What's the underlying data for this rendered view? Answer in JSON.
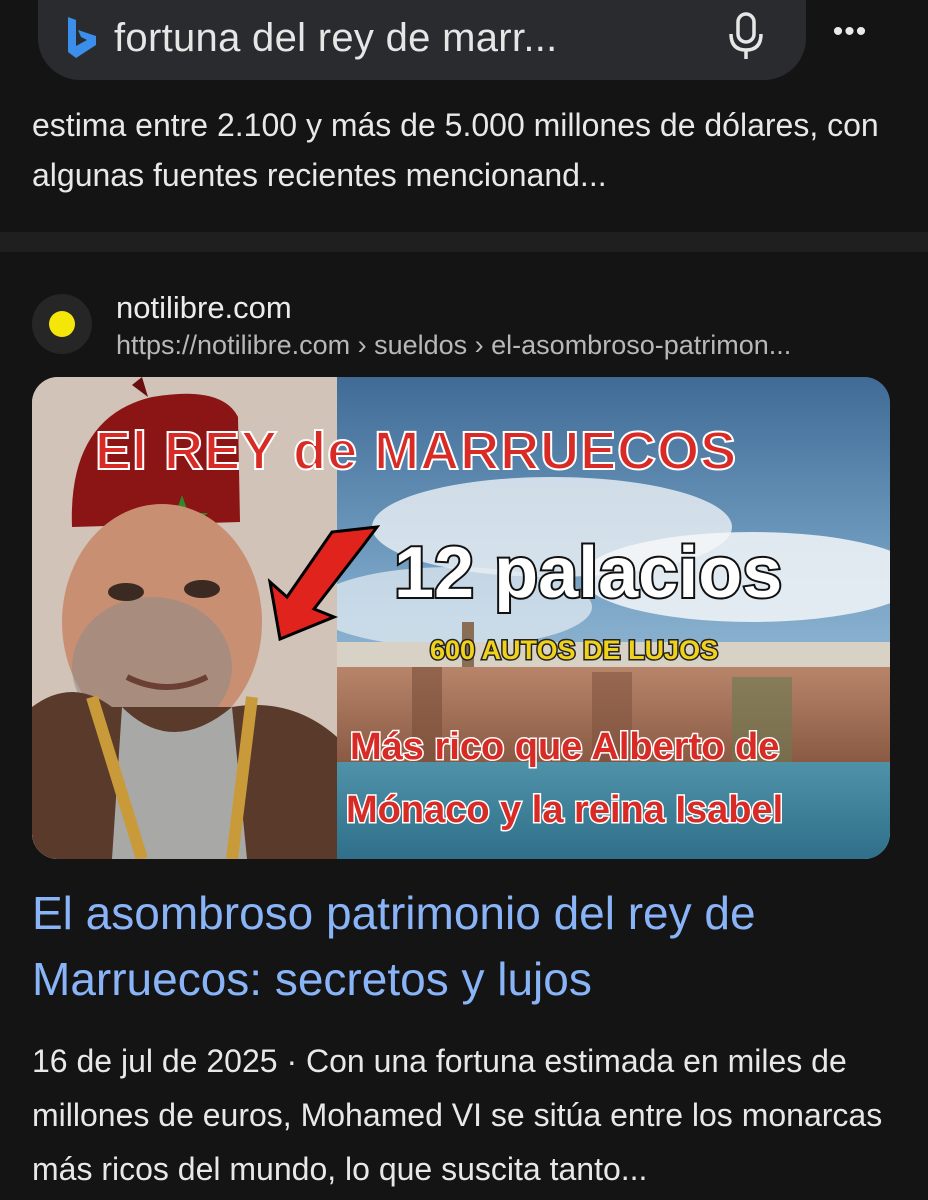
{
  "search": {
    "query": "fortuna del rey de marr...",
    "more_label": "•••"
  },
  "previous_result": {
    "snippet": "estima entre 2.100 y más de 5.000 millones de dólares, con algunas fuentes recientes mencionand..."
  },
  "result": {
    "site_name": "notilibre.com",
    "url": "https://notilibre.com › sueldos › el-asombroso-patrimon...",
    "image_text": {
      "headline": "El REY de MARRUECOS",
      "palaces": "12 palacios",
      "cars": "600 AUTOS DE LUJOS",
      "line1": "Más rico que Alberto de",
      "line2": "Mónaco y la reina Isabel"
    },
    "title": "El asombroso patrimonio del rey de Marruecos: secretos y lujos",
    "date": "16 de jul de 2025",
    "separator": "·",
    "description": "Con una fortuna estimada en miles de millones de euros, Mohamed VI se sitúa entre los monarcas más ricos del mundo, lo que suscita tanto..."
  },
  "colors": {
    "background": "#1f1f1f",
    "card": "#141414",
    "link": "#8ab4f8",
    "headline_red": "#d92b25",
    "bing_blue": "#3b8ee9"
  }
}
